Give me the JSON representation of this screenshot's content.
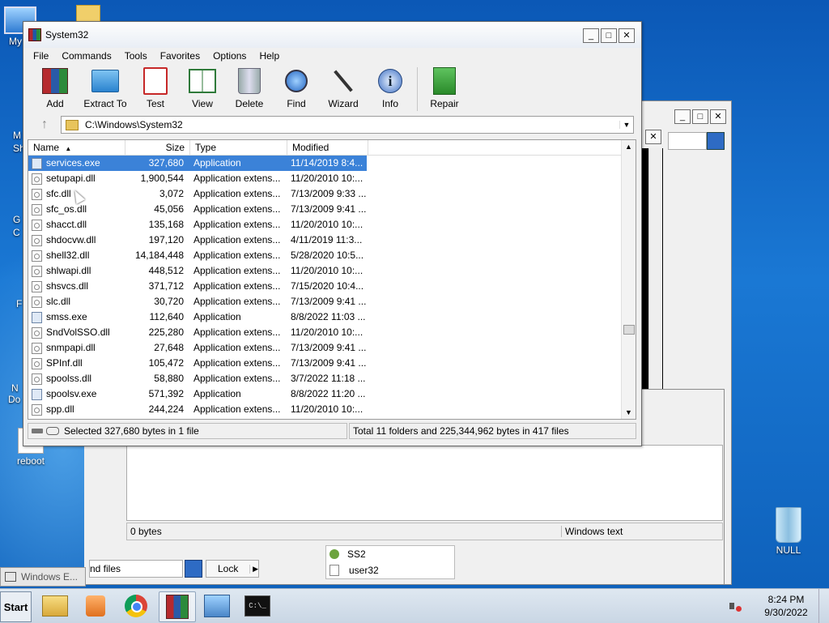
{
  "desktop": {
    "icons": [
      {
        "label": "My C"
      },
      {
        "label": "reboot"
      },
      {
        "label": "NULL"
      }
    ],
    "partial_labels": [
      "M",
      "Sh",
      "G",
      "C",
      "F",
      "N",
      "Do"
    ]
  },
  "back_window": {
    "status_left": "0 bytes",
    "status_right": "Windows text",
    "search_placeholder": "nd files",
    "lock_label": "Lock",
    "list_items": [
      "SS2",
      "user32"
    ],
    "task_label": "Windows E..."
  },
  "rar": {
    "title": "System32",
    "menu": [
      "File",
      "Commands",
      "Tools",
      "Favorites",
      "Options",
      "Help"
    ],
    "toolbar": [
      {
        "label": "Add",
        "icon": "add-archive-icon"
      },
      {
        "label": "Extract To",
        "icon": "extract-folder-icon"
      },
      {
        "label": "Test",
        "icon": "test-icon"
      },
      {
        "label": "View",
        "icon": "view-book-icon"
      },
      {
        "label": "Delete",
        "icon": "trash-icon"
      },
      {
        "label": "Find",
        "icon": "magnifier-icon"
      },
      {
        "label": "Wizard",
        "icon": "wand-icon"
      },
      {
        "label": "Info",
        "icon": "info-icon"
      },
      {
        "label": "Repair",
        "icon": "repair-icon"
      }
    ],
    "path": "C:\\Windows\\System32",
    "columns": {
      "name": "Name",
      "size": "Size",
      "type": "Type",
      "modified": "Modified"
    },
    "files": [
      {
        "name": "services.exe",
        "size": "327,680",
        "type": "Application",
        "modified": "11/14/2019 8:4...",
        "kind": "app",
        "selected": true
      },
      {
        "name": "setupapi.dll",
        "size": "1,900,544",
        "type": "Application extens...",
        "modified": "11/20/2010 10:...",
        "kind": "dll"
      },
      {
        "name": "sfc.dll",
        "size": "3,072",
        "type": "Application extens...",
        "modified": "7/13/2009 9:33 ...",
        "kind": "dll"
      },
      {
        "name": "sfc_os.dll",
        "size": "45,056",
        "type": "Application extens...",
        "modified": "7/13/2009 9:41 ...",
        "kind": "dll"
      },
      {
        "name": "shacct.dll",
        "size": "135,168",
        "type": "Application extens...",
        "modified": "11/20/2010 10:...",
        "kind": "dll"
      },
      {
        "name": "shdocvw.dll",
        "size": "197,120",
        "type": "Application extens...",
        "modified": "4/11/2019 11:3...",
        "kind": "dll"
      },
      {
        "name": "shell32.dll",
        "size": "14,184,448",
        "type": "Application extens...",
        "modified": "5/28/2020 10:5...",
        "kind": "dll"
      },
      {
        "name": "shlwapi.dll",
        "size": "448,512",
        "type": "Application extens...",
        "modified": "11/20/2010 10:...",
        "kind": "dll"
      },
      {
        "name": "shsvcs.dll",
        "size": "371,712",
        "type": "Application extens...",
        "modified": "7/15/2020 10:4...",
        "kind": "dll"
      },
      {
        "name": "slc.dll",
        "size": "30,720",
        "type": "Application extens...",
        "modified": "7/13/2009 9:41 ...",
        "kind": "dll"
      },
      {
        "name": "smss.exe",
        "size": "112,640",
        "type": "Application",
        "modified": "8/8/2022 11:03 ...",
        "kind": "app"
      },
      {
        "name": "SndVolSSO.dll",
        "size": "225,280",
        "type": "Application extens...",
        "modified": "11/20/2010 10:...",
        "kind": "dll"
      },
      {
        "name": "snmpapi.dll",
        "size": "27,648",
        "type": "Application extens...",
        "modified": "7/13/2009 9:41 ...",
        "kind": "dll"
      },
      {
        "name": "SPInf.dll",
        "size": "105,472",
        "type": "Application extens...",
        "modified": "7/13/2009 9:41 ...",
        "kind": "dll"
      },
      {
        "name": "spoolss.dll",
        "size": "58,880",
        "type": "Application extens...",
        "modified": "3/7/2022 11:18 ...",
        "kind": "dll"
      },
      {
        "name": "spoolsv.exe",
        "size": "571,392",
        "type": "Application",
        "modified": "8/8/2022 11:20 ...",
        "kind": "app"
      },
      {
        "name": "spp.dll",
        "size": "244,224",
        "type": "Application extens...",
        "modified": "11/20/2010 10:...",
        "kind": "dll"
      }
    ],
    "status_left": "Selected 327,680 bytes in 1 file",
    "status_right": "Total 11 folders and 225,344,962 bytes in 417 files"
  },
  "taskbar": {
    "start_label": "Start",
    "apps": [
      "explorer-folder-icon",
      "media-player-icon",
      "chrome-icon",
      "winrar-icon",
      "control-panel-icon",
      "cmd-icon"
    ],
    "time": "8:24 PM",
    "date": "9/30/2022"
  }
}
